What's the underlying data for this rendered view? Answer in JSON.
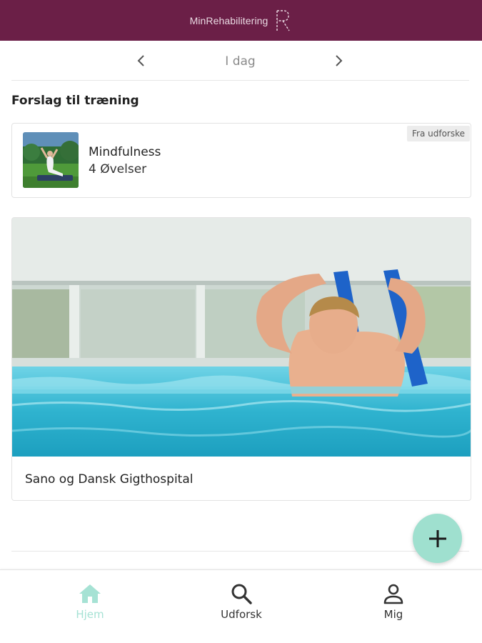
{
  "header": {
    "title": "MinRehabilitering",
    "logo_icon": "r-logo-icon",
    "bg_color": "#6b1f47"
  },
  "date_nav": {
    "label": "I dag",
    "prev_icon": "chevron-left-icon",
    "next_icon": "chevron-right-icon"
  },
  "suggestions": {
    "title": "Forslag til træning",
    "card": {
      "title": "Mindfulness",
      "subtitle": "4 Øvelser",
      "badge": "Fra udforske",
      "thumb": "mindfulness-photo"
    }
  },
  "feature": {
    "caption": "Sano og Dansk Gigthospital",
    "image": "pool-exercise-photo"
  },
  "fab": {
    "icon": "plus-icon",
    "color": "#9fe0cf"
  },
  "bottom_nav": {
    "items": [
      {
        "label": "Hjem",
        "icon": "home-icon",
        "active": true
      },
      {
        "label": "Udforsk",
        "icon": "search-icon",
        "active": false
      },
      {
        "label": "Mig",
        "icon": "person-icon",
        "active": false
      }
    ],
    "active_color": "#a6e2d4"
  }
}
